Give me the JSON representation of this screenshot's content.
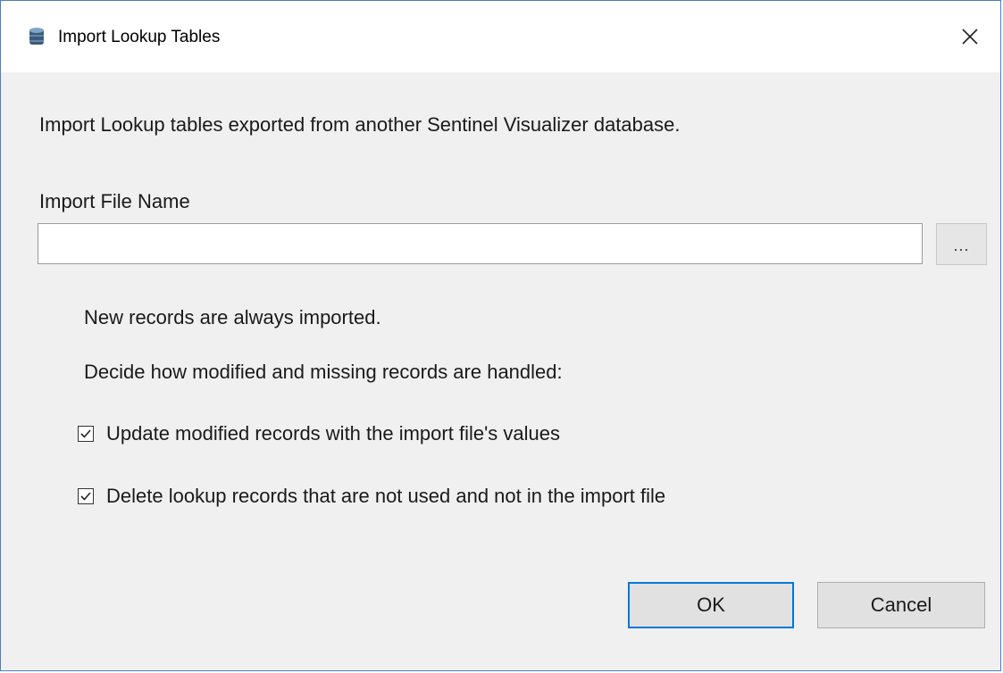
{
  "window": {
    "title": "Import Lookup Tables",
    "icon": "database-icon",
    "close_icon": "close-icon"
  },
  "description": "Import Lookup tables exported from another Sentinel Visualizer database.",
  "import_file": {
    "label": "Import File Name",
    "value": "",
    "browse_label": "..."
  },
  "info": {
    "new_records": "New records are always imported.",
    "decide": "Decide how modified and missing records are handled:"
  },
  "options": {
    "update_modified": {
      "label": "Update modified records with the import file's values",
      "checked": true
    },
    "delete_unused": {
      "label": "Delete lookup records that are not used and not in the import file",
      "checked": true
    }
  },
  "buttons": {
    "ok": "OK",
    "cancel": "Cancel"
  },
  "colors": {
    "accent": "#0078d7",
    "window_border": "#4a7fc0",
    "background": "#f0f0f0"
  }
}
